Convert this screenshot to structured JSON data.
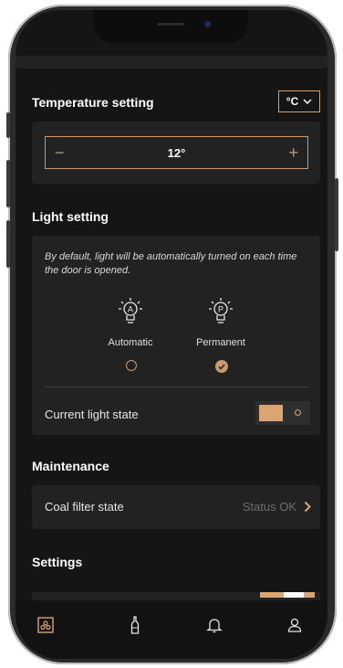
{
  "temperature": {
    "title": "Temperature setting",
    "unit": "°C",
    "value": "12°",
    "minus": "−",
    "plus": "+"
  },
  "light": {
    "title": "Light setting",
    "description": "By default, light will be automatically turned on each time the door is opened.",
    "modes": [
      {
        "label": "Automatic",
        "icon": "bulb-a",
        "letter": "A",
        "selected": false
      },
      {
        "label": "Permanent",
        "icon": "bulb-p",
        "letter": "P",
        "selected": true
      }
    ],
    "current_state_label": "Current light state",
    "current_state_on": true
  },
  "maintenance": {
    "title": "Maintenance",
    "coal_filter_label": "Coal filter state",
    "coal_filter_status": "Status OK"
  },
  "settings": {
    "title": "Settings"
  },
  "colors": {
    "accent": "#c99a72",
    "background": "#151515",
    "card": "#222222"
  },
  "tabbar": {
    "items": [
      {
        "icon": "wine-cellar-icon",
        "active": true
      },
      {
        "icon": "bottle-icon",
        "active": false
      },
      {
        "icon": "bell-icon",
        "active": false
      },
      {
        "icon": "user-icon",
        "active": false
      }
    ]
  }
}
